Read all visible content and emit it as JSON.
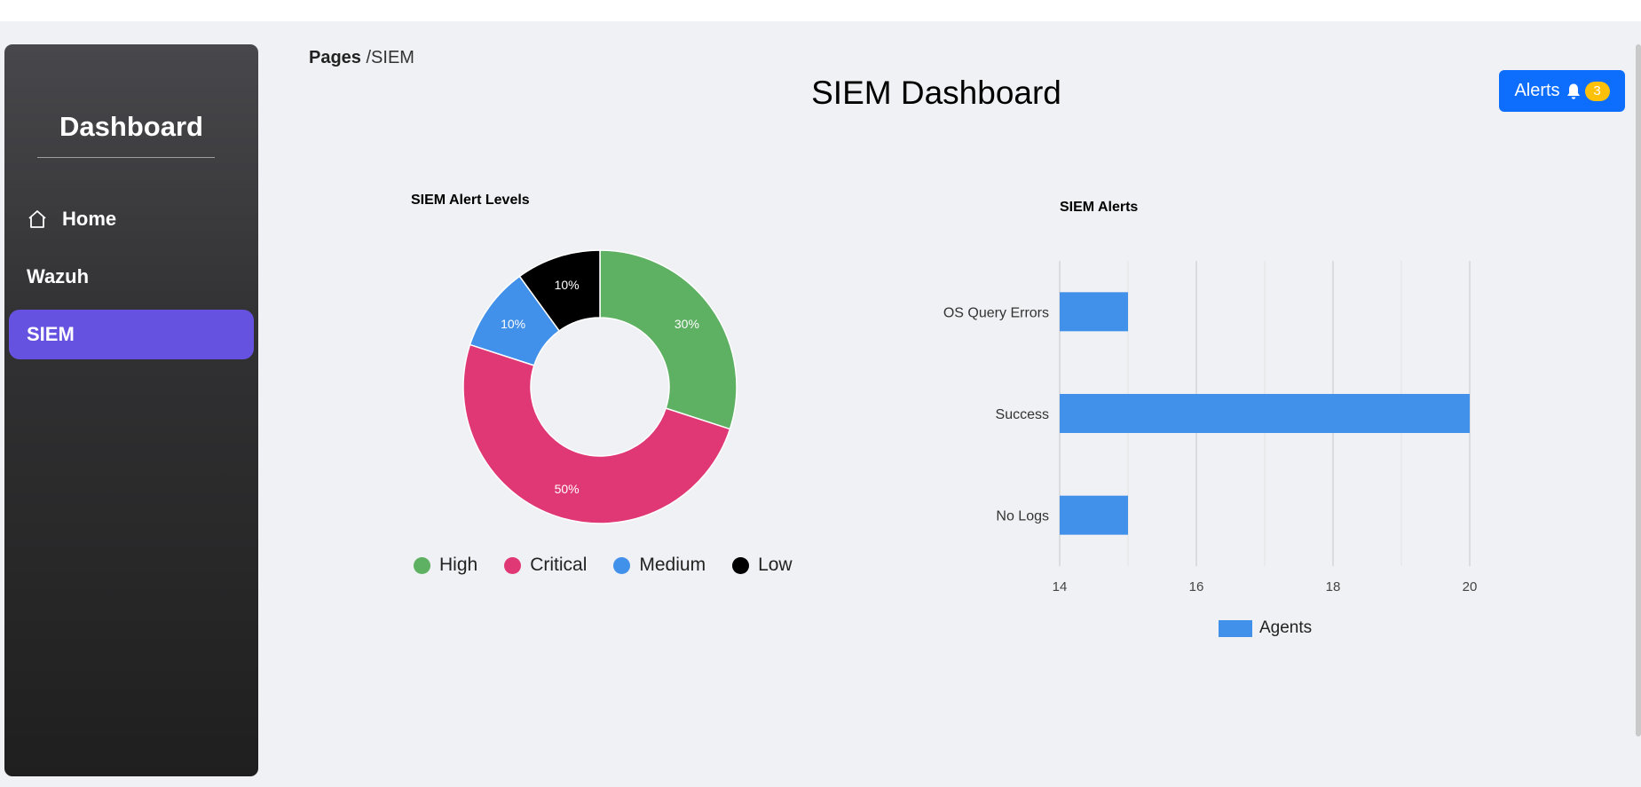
{
  "sidebar": {
    "brand": "Dashboard",
    "items": [
      {
        "label": "Home",
        "icon": "home-icon",
        "active": false
      },
      {
        "label": "Wazuh",
        "icon": "",
        "active": false
      },
      {
        "label": "SIEM",
        "icon": "",
        "active": true
      }
    ]
  },
  "breadcrumb": {
    "root": "Pages",
    "current": "/SIEM"
  },
  "page_title": "SIEM Dashboard",
  "alerts_button": {
    "label": "Alerts",
    "icon": "bell-icon",
    "count": "3"
  },
  "colors": {
    "active_nav": "#6652e0",
    "alerts_button": "#0d6efd",
    "badge": "#ffc107",
    "high": "#5eb062",
    "critical": "#e03875",
    "medium": "#4190ea",
    "low": "#000000",
    "bar": "#4190ea"
  },
  "chart_data": [
    {
      "type": "pie",
      "title": "SIEM Alert Levels",
      "donut": true,
      "categories": [
        "High",
        "Critical",
        "Medium",
        "Low"
      ],
      "values": [
        30,
        50,
        10,
        10
      ],
      "labels": [
        "30%",
        "50%",
        "10%",
        "10%"
      ],
      "colors": [
        "#5eb062",
        "#e03875",
        "#4190ea",
        "#000000"
      ],
      "legend": "bottom"
    },
    {
      "type": "bar",
      "orientation": "horizontal",
      "title": "SIEM Alerts",
      "categories": [
        "OS Query Errors",
        "Success",
        "No Logs"
      ],
      "series": [
        {
          "name": "Agents",
          "values": [
            15,
            20,
            15
          ]
        }
      ],
      "xlim": [
        14,
        20
      ],
      "xticks": [
        "14",
        "16",
        "18",
        "20"
      ],
      "grid": true,
      "legend": "bottom"
    }
  ]
}
